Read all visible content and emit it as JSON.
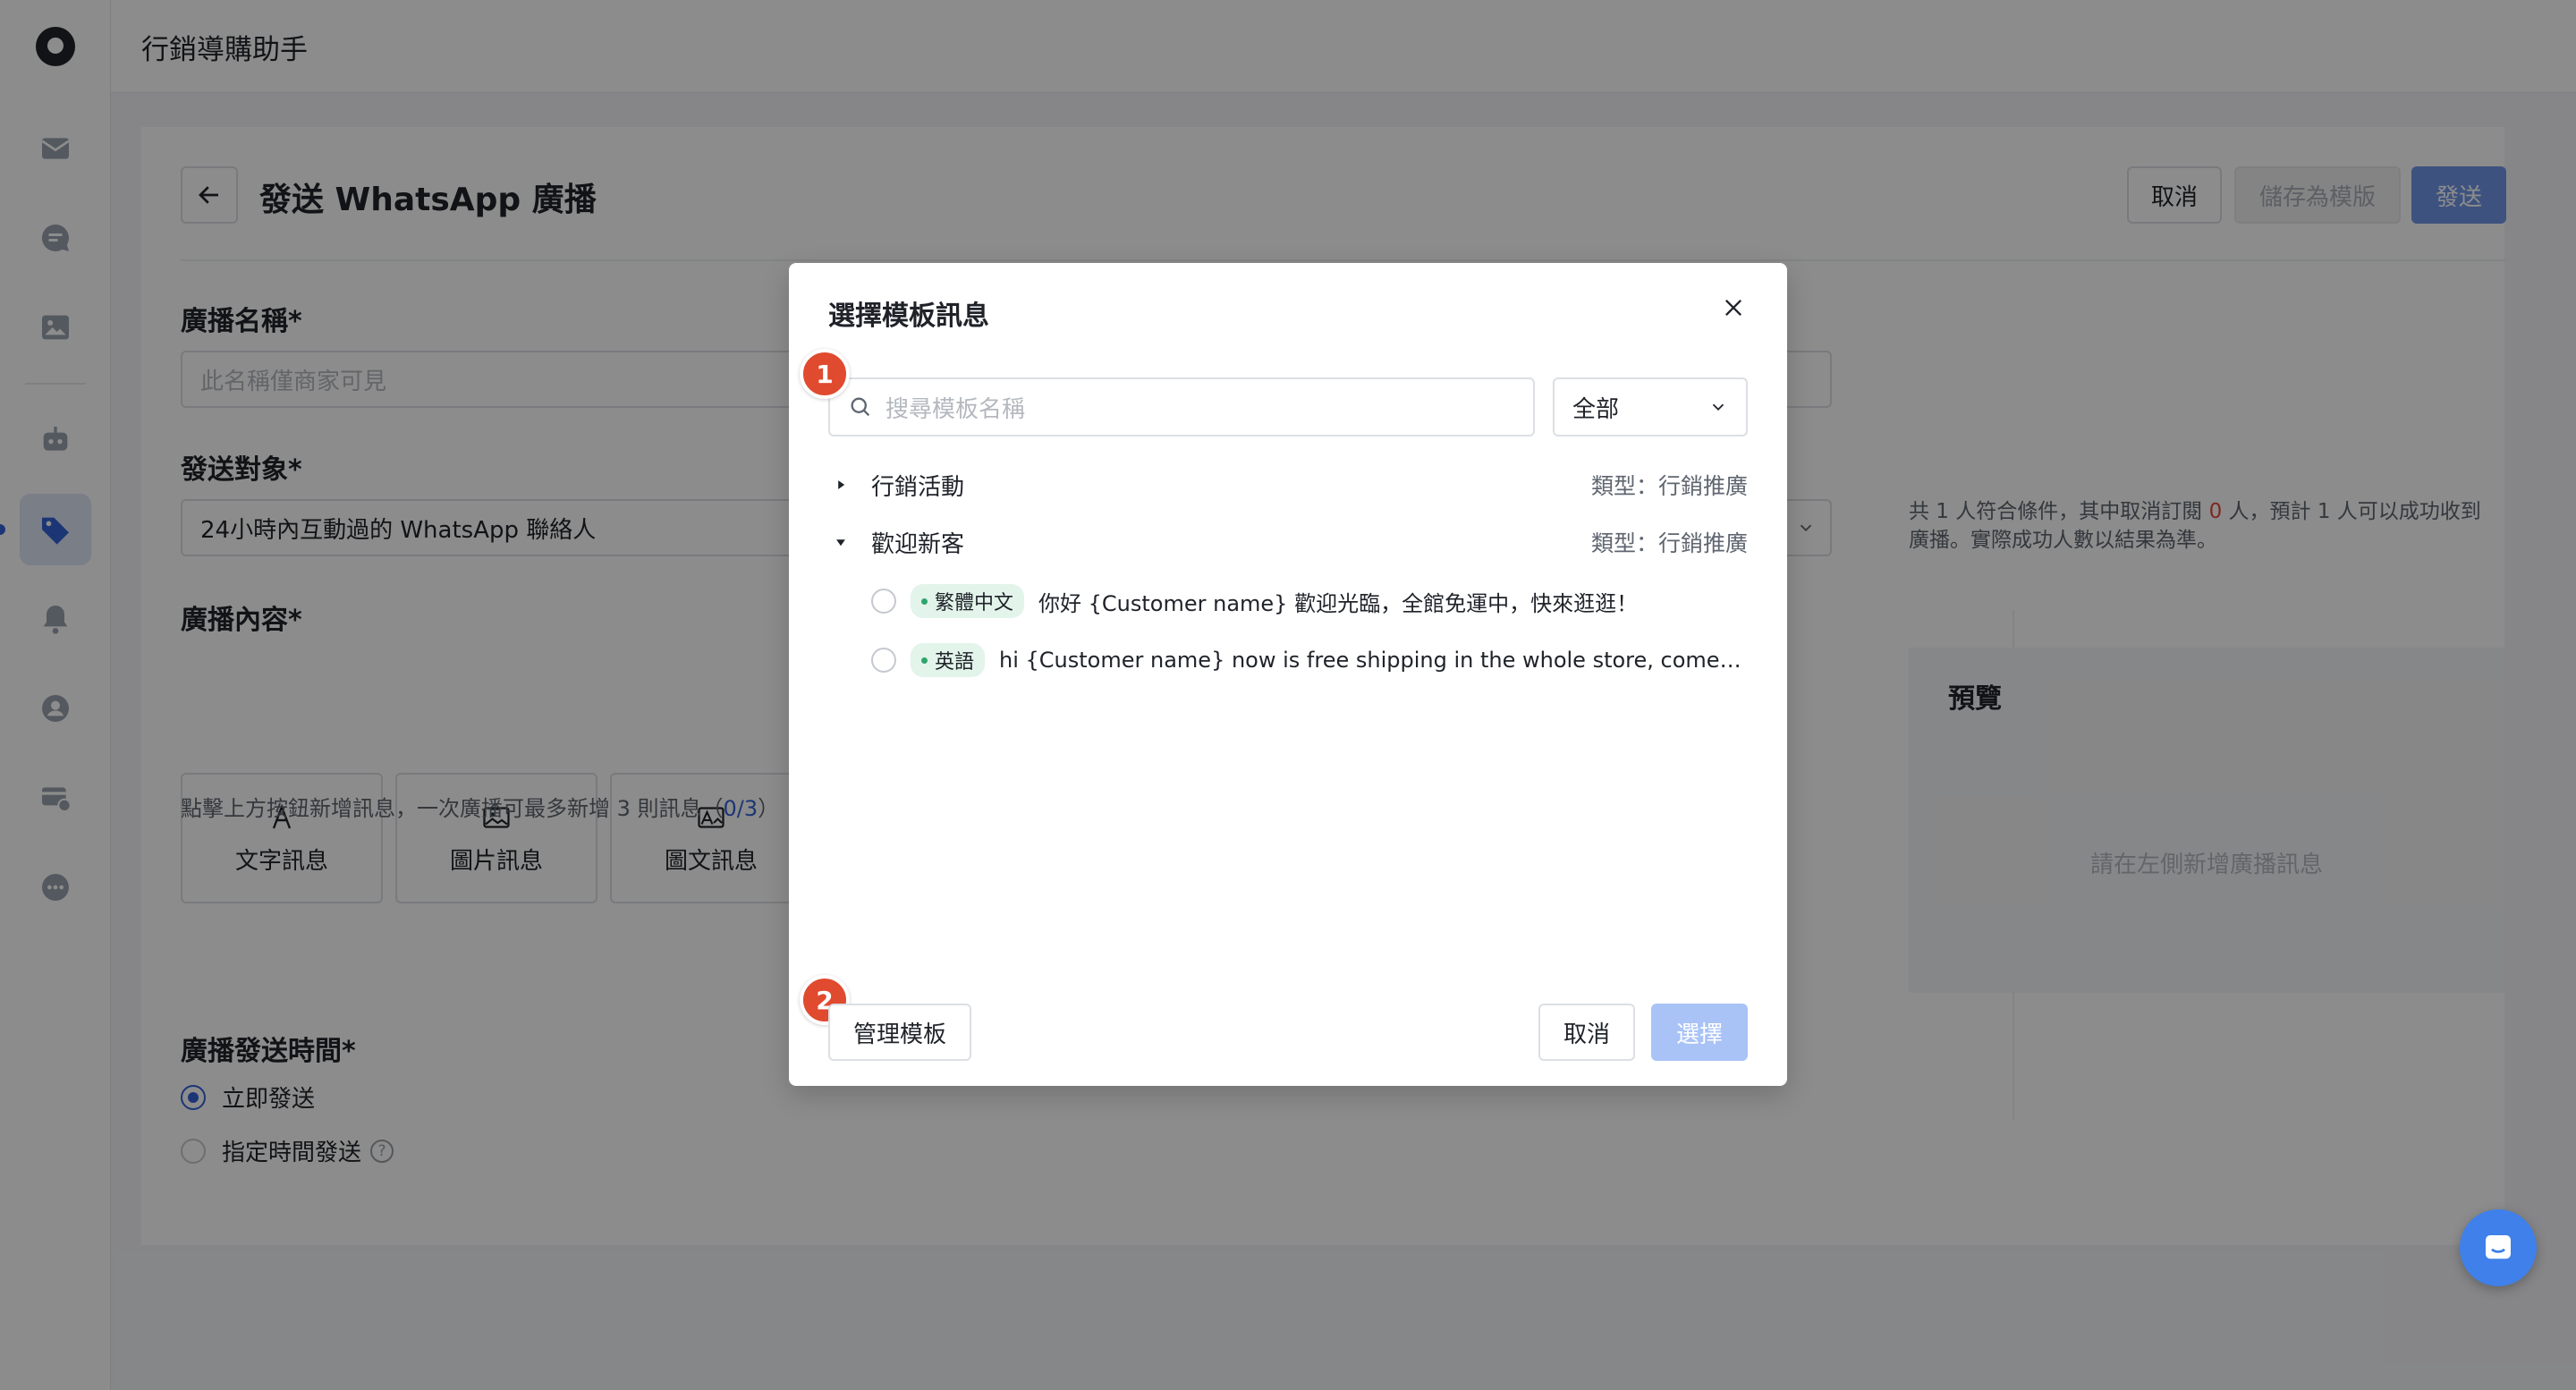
{
  "app": {
    "title": "行銷導購助手"
  },
  "page": {
    "title": "發送 WhatsApp 廣播",
    "cancel_label": "取消",
    "save_template_label": "儲存為模版",
    "send_label": "發送"
  },
  "form": {
    "broadcast_name_label": "廣播名稱*",
    "broadcast_name_placeholder": "此名稱僅商家可見",
    "audience_label": "發送對象*",
    "audience_value": "24小時內互動過的 WhatsApp 聯絡人",
    "audience_note_part1": "共 1 人符合條件，其中取消訂閱 ",
    "audience_note_unsub": "0",
    "audience_note_part2": " 人，預計 1 人可以成功收到廣播。實際成功人數以結果為準。",
    "content_label": "廣播內容*",
    "content_types": [
      "文字訊息",
      "圖片訊息",
      "圖文訊息"
    ],
    "content_hint_prefix": "點擊上方按鈕新增訊息，一次廣播可最多新增 3 則訊息（",
    "content_hint_count": "0/3",
    "content_hint_suffix": "）",
    "send_time_label": "廣播發送時間*",
    "send_now_label": "立即發送",
    "send_scheduled_label": "指定時間發送"
  },
  "preview": {
    "title": "預覽",
    "empty_text": "請在左側新增廣播訊息"
  },
  "modal": {
    "title": "選擇模板訊息",
    "search_placeholder": "搜尋模板名稱",
    "filter_value": "全部",
    "groups": [
      {
        "name": "行銷活動",
        "type": "類型：行銷推廣",
        "expanded": false
      },
      {
        "name": "歡迎新客",
        "type": "類型：行銷推廣",
        "expanded": true
      }
    ],
    "templates": [
      {
        "lang": "繁體中文",
        "text": "你好 {Customer name} 歡迎光臨，全館免運中，快來逛逛！"
      },
      {
        "lang": "英語",
        "text": "hi {Customer name} now is free shipping in the whole store, come an..."
      }
    ],
    "manage_label": "管理模板",
    "cancel_label": "取消",
    "select_label": "選擇",
    "step_badges": [
      "1",
      "2"
    ]
  },
  "icons": {
    "nav": [
      "inbox-icon",
      "chat-icon",
      "image-icon",
      "bot-icon",
      "tag-icon",
      "bell-icon",
      "contacts-icon",
      "card-settings-icon",
      "more-icon"
    ],
    "accent": "#3463d5"
  }
}
